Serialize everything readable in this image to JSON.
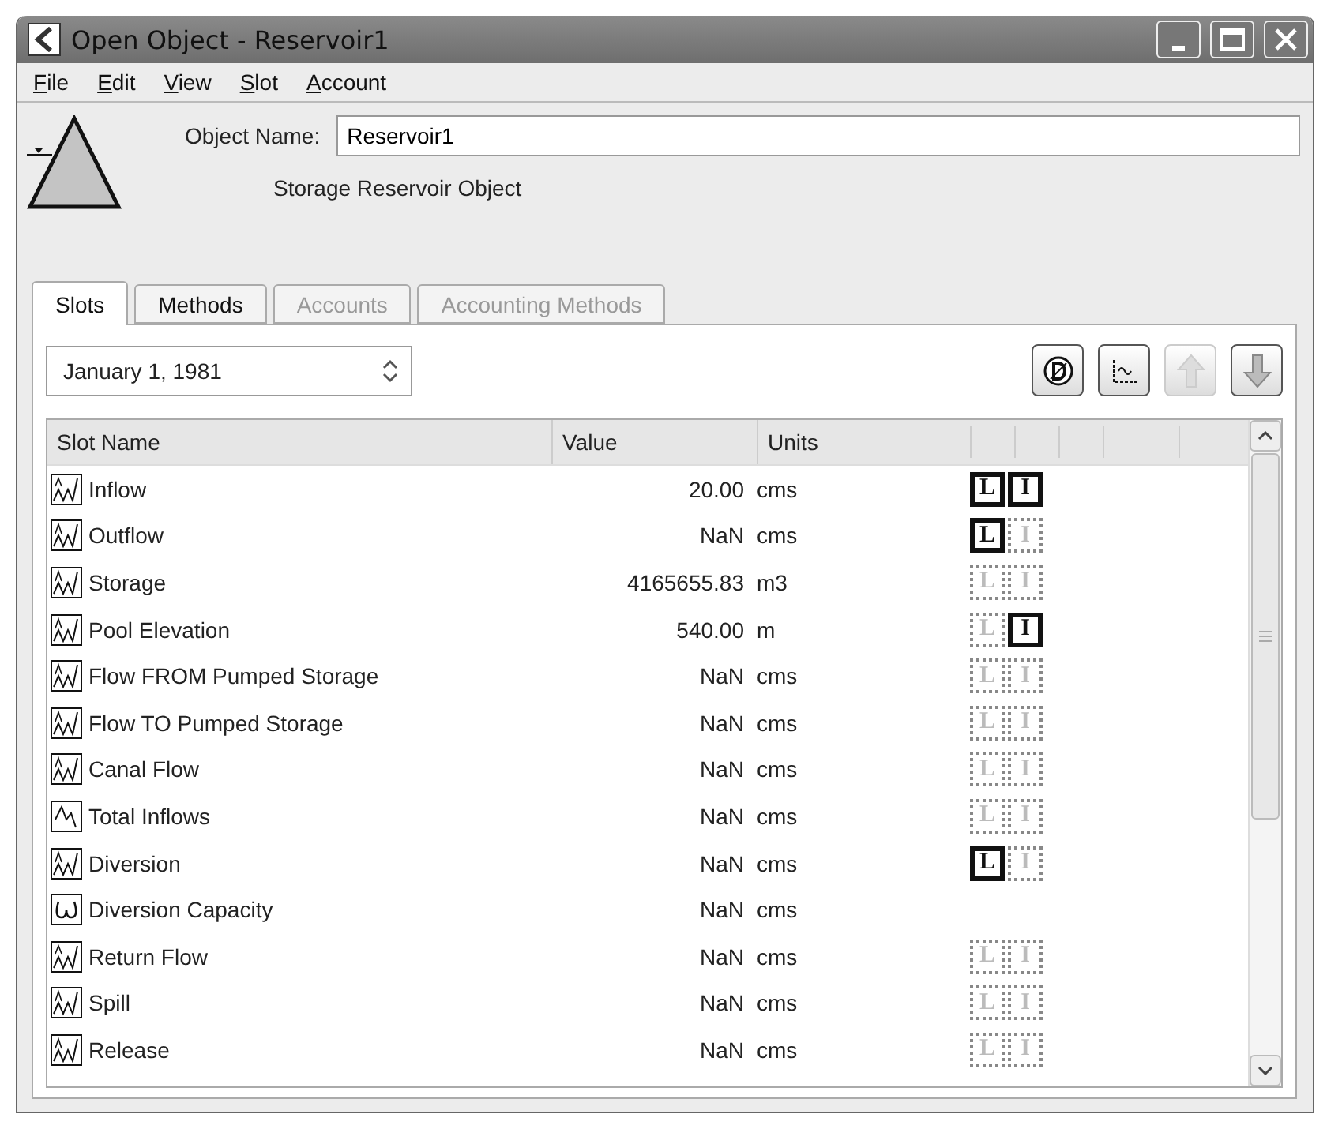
{
  "window": {
    "title": "Open Object - Reservoir1"
  },
  "menu": [
    "File",
    "Edit",
    "View",
    "Slot",
    "Account"
  ],
  "object": {
    "name_label": "Object Name:",
    "name": "Reservoir1",
    "type": "Storage Reservoir Object"
  },
  "tabs": [
    {
      "label": "Slots",
      "selected": true,
      "disabled": false
    },
    {
      "label": "Methods",
      "selected": false,
      "disabled": false
    },
    {
      "label": "Accounts",
      "selected": false,
      "disabled": true
    },
    {
      "label": "Accounting Methods",
      "selected": false,
      "disabled": true
    }
  ],
  "date": {
    "value": "January 1, 1981"
  },
  "toolbar": [
    {
      "kind": "dispatch",
      "disabled": false
    },
    {
      "kind": "plot",
      "disabled": false
    },
    {
      "kind": "up",
      "disabled": true
    },
    {
      "kind": "down",
      "disabled": false
    }
  ],
  "table": {
    "columns": [
      "Slot Name",
      "Value",
      "Units"
    ],
    "rows": [
      {
        "kind": "series-m",
        "name": "Inflow",
        "value": "20.00",
        "units": "cms",
        "flags": [
          {
            "letter": "L",
            "on": true
          },
          {
            "letter": "I",
            "on": true
          }
        ]
      },
      {
        "kind": "series",
        "name": "Outflow",
        "value": "NaN",
        "units": "cms",
        "flags": [
          {
            "letter": "L",
            "on": true
          },
          {
            "letter": "I",
            "on": false
          }
        ]
      },
      {
        "kind": "series",
        "name": "Storage",
        "value": "4165655.83",
        "units": "m3",
        "flags": [
          {
            "letter": "L",
            "on": false
          },
          {
            "letter": "I",
            "on": false
          }
        ]
      },
      {
        "kind": "series",
        "name": "Pool Elevation",
        "value": "540.00",
        "units": "m",
        "flags": [
          {
            "letter": "L",
            "on": false
          },
          {
            "letter": "I",
            "on": true
          }
        ]
      },
      {
        "kind": "series",
        "name": "Flow FROM Pumped Storage",
        "value": "NaN",
        "units": "cms",
        "flags": [
          {
            "letter": "L",
            "on": false
          },
          {
            "letter": "I",
            "on": false
          }
        ]
      },
      {
        "kind": "series",
        "name": "Flow TO Pumped Storage",
        "value": "NaN",
        "units": "cms",
        "flags": [
          {
            "letter": "L",
            "on": false
          },
          {
            "letter": "I",
            "on": false
          }
        ]
      },
      {
        "kind": "series",
        "name": "Canal Flow",
        "value": "NaN",
        "units": "cms",
        "flags": [
          {
            "letter": "L",
            "on": false
          },
          {
            "letter": "I",
            "on": false
          }
        ]
      },
      {
        "kind": "aggregate",
        "name": "Total Inflows",
        "value": "NaN",
        "units": "cms",
        "flags": [
          {
            "letter": "L",
            "on": false
          },
          {
            "letter": "I",
            "on": false
          }
        ]
      },
      {
        "kind": "series",
        "name": "Diversion",
        "value": "NaN",
        "units": "cms",
        "flags": [
          {
            "letter": "L",
            "on": true
          },
          {
            "letter": "I",
            "on": false
          }
        ]
      },
      {
        "kind": "periodic",
        "name": "Diversion Capacity",
        "value": "NaN",
        "units": "cms"
      },
      {
        "kind": "series-m",
        "name": "Return Flow",
        "value": "NaN",
        "units": "cms",
        "flags": [
          {
            "letter": "L",
            "on": false
          },
          {
            "letter": "I",
            "on": false
          }
        ]
      },
      {
        "kind": "series",
        "name": "Spill",
        "value": "NaN",
        "units": "cms",
        "flags": [
          {
            "letter": "L",
            "on": false
          },
          {
            "letter": "I",
            "on": false
          }
        ]
      },
      {
        "kind": "series",
        "name": "Release",
        "value": "NaN",
        "units": "cms",
        "flags": [
          {
            "letter": "L",
            "on": false
          },
          {
            "letter": "I",
            "on": false
          }
        ]
      }
    ]
  }
}
